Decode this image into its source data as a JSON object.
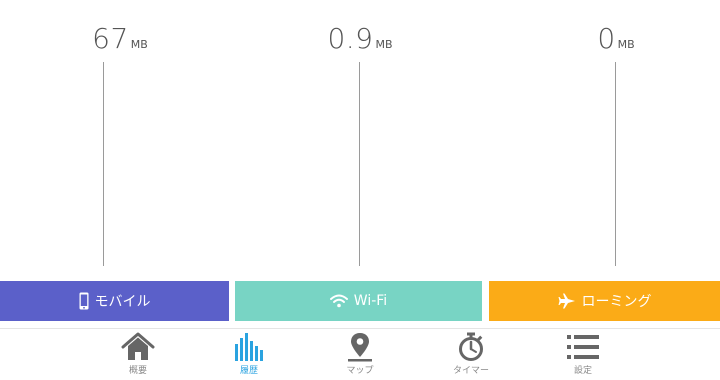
{
  "usage": {
    "mobile": {
      "value": "67",
      "unit": "MB"
    },
    "wifi": {
      "value": "0.9",
      "unit": "MB"
    },
    "roaming": {
      "value": "0",
      "unit": "MB"
    }
  },
  "networks": {
    "mobile": {
      "label": "モバイル",
      "color": "#5b60c9",
      "icon": "smartphone-icon"
    },
    "wifi": {
      "label": "Wi-Fi",
      "color": "#78d4c4",
      "icon": "wifi-icon"
    },
    "roaming": {
      "label": "ローミング",
      "color": "#fbab17",
      "icon": "airplane-icon"
    }
  },
  "tabs": [
    {
      "label": "概要",
      "icon": "home-icon",
      "active": false
    },
    {
      "label": "履歴",
      "icon": "bar-chart-icon",
      "active": true
    },
    {
      "label": "マップ",
      "icon": "map-pin-icon",
      "active": false
    },
    {
      "label": "タイマー",
      "icon": "stopwatch-icon",
      "active": false
    },
    {
      "label": "設定",
      "icon": "list-icon",
      "active": false
    }
  ],
  "colors": {
    "tab_active": "#2aa3e0",
    "tab_inactive": "#666666"
  }
}
